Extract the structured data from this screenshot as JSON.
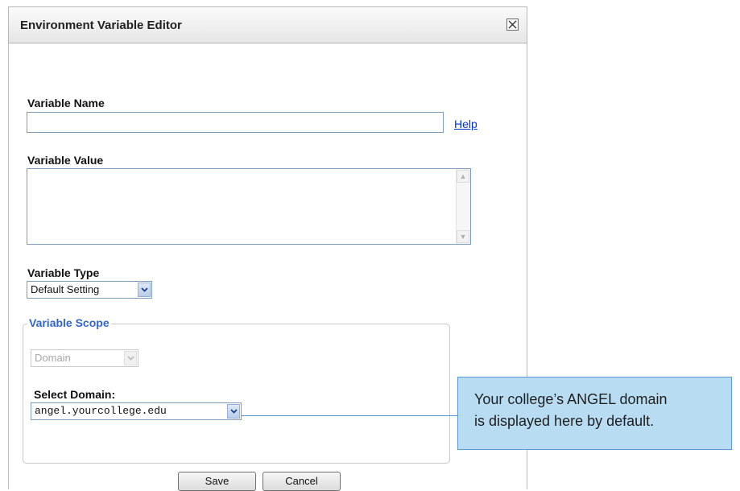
{
  "dialog": {
    "title": "Environment Variable Editor",
    "close_icon": "close-icon"
  },
  "variable_name": {
    "label": "Variable Name",
    "value": "",
    "help_link": "Help"
  },
  "variable_value": {
    "label": "Variable Value",
    "value": ""
  },
  "variable_type": {
    "label": "Variable Type",
    "selected": "Default Setting"
  },
  "variable_scope": {
    "legend": "Variable Scope",
    "scope_selected": "Domain",
    "select_domain_label": "Select Domain:",
    "domain_selected": "angel.yourcollege.edu"
  },
  "buttons": {
    "save": "Save",
    "cancel": "Cancel"
  },
  "callout": {
    "line1": "Your college’s ANGEL domain",
    "line2": "is displayed here by default."
  },
  "colors": {
    "legend": "#3366cc",
    "link": "#0033cc",
    "callout_fill": "#b8dcf2",
    "callout_border": "#5b9bd5"
  }
}
